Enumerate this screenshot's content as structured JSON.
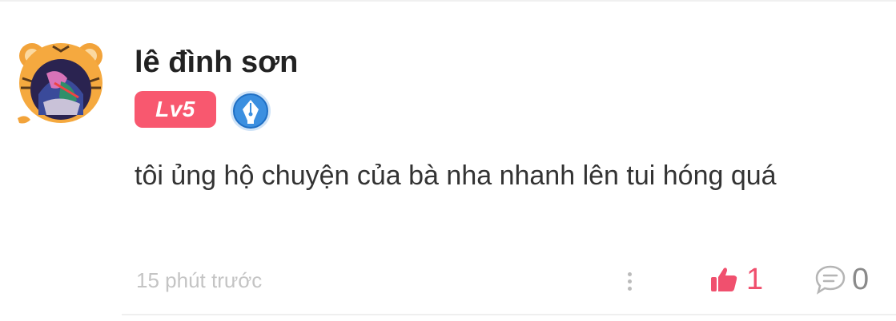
{
  "comment": {
    "author": "lê đình sơn",
    "level": "Lv5",
    "text": "tôi ủng hộ chuyện của bà nha nhanh lên tui hóng quá",
    "timestamp": "15 phút trước",
    "like_count": "1",
    "reply_count": "0"
  },
  "colors": {
    "level_badge": "#f8586f",
    "like_accent": "#f0506e",
    "writer_badge": "#3b8fe0"
  },
  "icons": {
    "avatar": "tiger-avatar-icon",
    "writer_badge": "pen-nib-badge-icon",
    "more": "vertical-dots-icon",
    "like": "thumbs-up-icon",
    "reply": "speech-bubble-icon"
  }
}
